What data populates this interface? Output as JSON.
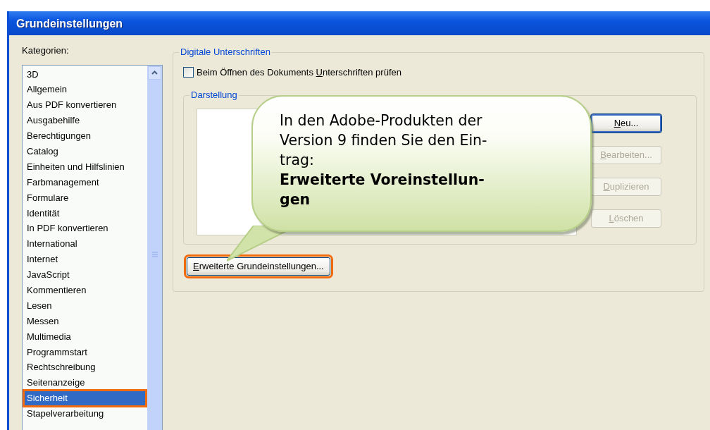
{
  "window": {
    "title": "Grundeinstellungen"
  },
  "categories": {
    "label": {
      "before": "Kate",
      "key": "g",
      "after": "orien:"
    },
    "items": [
      {
        "label": "3D",
        "selected": false,
        "highlighted": false
      },
      {
        "label": "Allgemein",
        "selected": false,
        "highlighted": false
      },
      {
        "label": "Aus PDF konvertieren",
        "selected": false,
        "highlighted": false
      },
      {
        "label": "Ausgabehilfe",
        "selected": false,
        "highlighted": false
      },
      {
        "label": "Berechtigungen",
        "selected": false,
        "highlighted": false
      },
      {
        "label": "Catalog",
        "selected": false,
        "highlighted": false
      },
      {
        "label": "Einheiten und Hilfslinien",
        "selected": false,
        "highlighted": false
      },
      {
        "label": "Farbmanagement",
        "selected": false,
        "highlighted": false
      },
      {
        "label": "Formulare",
        "selected": false,
        "highlighted": false
      },
      {
        "label": "Identität",
        "selected": false,
        "highlighted": false
      },
      {
        "label": "In PDF konvertieren",
        "selected": false,
        "highlighted": false
      },
      {
        "label": "International",
        "selected": false,
        "highlighted": false
      },
      {
        "label": "Internet",
        "selected": false,
        "highlighted": false
      },
      {
        "label": "JavaScript",
        "selected": false,
        "highlighted": false
      },
      {
        "label": "Kommentieren",
        "selected": false,
        "highlighted": false
      },
      {
        "label": "Lesen",
        "selected": false,
        "highlighted": false
      },
      {
        "label": "Messen",
        "selected": false,
        "highlighted": false
      },
      {
        "label": "Multimedia",
        "selected": false,
        "highlighted": false
      },
      {
        "label": "Programmstart",
        "selected": false,
        "highlighted": false
      },
      {
        "label": "Rechtschreibung",
        "selected": false,
        "highlighted": false
      },
      {
        "label": "Seitenanzeige",
        "selected": false,
        "highlighted": false
      },
      {
        "label": "Sicherheit",
        "selected": true,
        "highlighted": true
      },
      {
        "label": "Stapelverarbeitung",
        "selected": false,
        "highlighted": false
      }
    ]
  },
  "signatures": {
    "title": "Digitale Unterschriften",
    "checkbox": {
      "label": {
        "before": "Beim Öffnen des Dokuments ",
        "key": "U",
        "after": "nterschriften prüfen"
      },
      "checked": false
    },
    "appearance": {
      "title": "Darstellung",
      "buttons": [
        {
          "label": {
            "key": "N",
            "after": "eu..."
          },
          "disabled": false,
          "default": true
        },
        {
          "label": {
            "key": "B",
            "after": "earbeiten..."
          },
          "disabled": true,
          "default": false
        },
        {
          "label": {
            "key": "D",
            "after": "uplizieren"
          },
          "disabled": true,
          "default": false
        },
        {
          "label": {
            "key": "L",
            "after": "öschen"
          },
          "disabled": true,
          "default": false
        }
      ]
    },
    "advanced_button": {
      "label": {
        "key": "E",
        "after": "rweiterte Grundeinstellungen..."
      },
      "highlighted": true
    }
  },
  "callout": {
    "lines": [
      {
        "text": "In den Adobe-Produkten der",
        "bold": false
      },
      {
        "text": "Version 9 finden Sie den Ein-",
        "bold": false
      },
      {
        "text": "trag:",
        "bold": false
      },
      {
        "text": "Erweiterte Voreinstellun-",
        "bold": true
      },
      {
        "text": "gen",
        "bold": true
      }
    ]
  }
}
